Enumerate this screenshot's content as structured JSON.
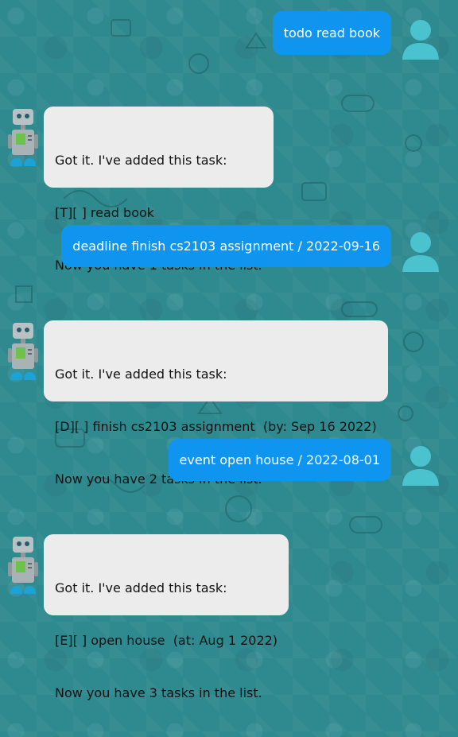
{
  "conversation": [
    {
      "role": "user",
      "text": "todo read book"
    },
    {
      "role": "bot",
      "lines": [
        "Got it. I've added this task:",
        "[T][ ] read book",
        "Now you have 1 tasks in the list."
      ]
    },
    {
      "role": "user",
      "text": "deadline finish cs2103 assignment / 2022-09-16"
    },
    {
      "role": "bot",
      "lines": [
        "Got it. I've added this task:",
        "[D][ ] finish cs2103 assignment  (by: Sep 16 2022)",
        "Now you have 2 tasks in the list."
      ]
    },
    {
      "role": "user",
      "text": "event open house / 2022-08-01"
    },
    {
      "role": "bot",
      "lines": [
        "Got it. I've added this task:",
        "[E][ ] open house  (at: Aug 1 2022)",
        "Now you have 3 tasks in the list."
      ]
    }
  ],
  "colors": {
    "background": "#2f8a90",
    "user_bubble": "#0f95ef",
    "bot_bubble": "#ececec",
    "user_avatar": "#4bc3cf",
    "robot_body": "#a9b3b6",
    "robot_screen": "#6cc24a",
    "robot_feet": "#1ca3d6"
  },
  "icons": {
    "user_avatar": "user-avatar-icon",
    "bot_avatar": "robot-avatar-icon"
  }
}
